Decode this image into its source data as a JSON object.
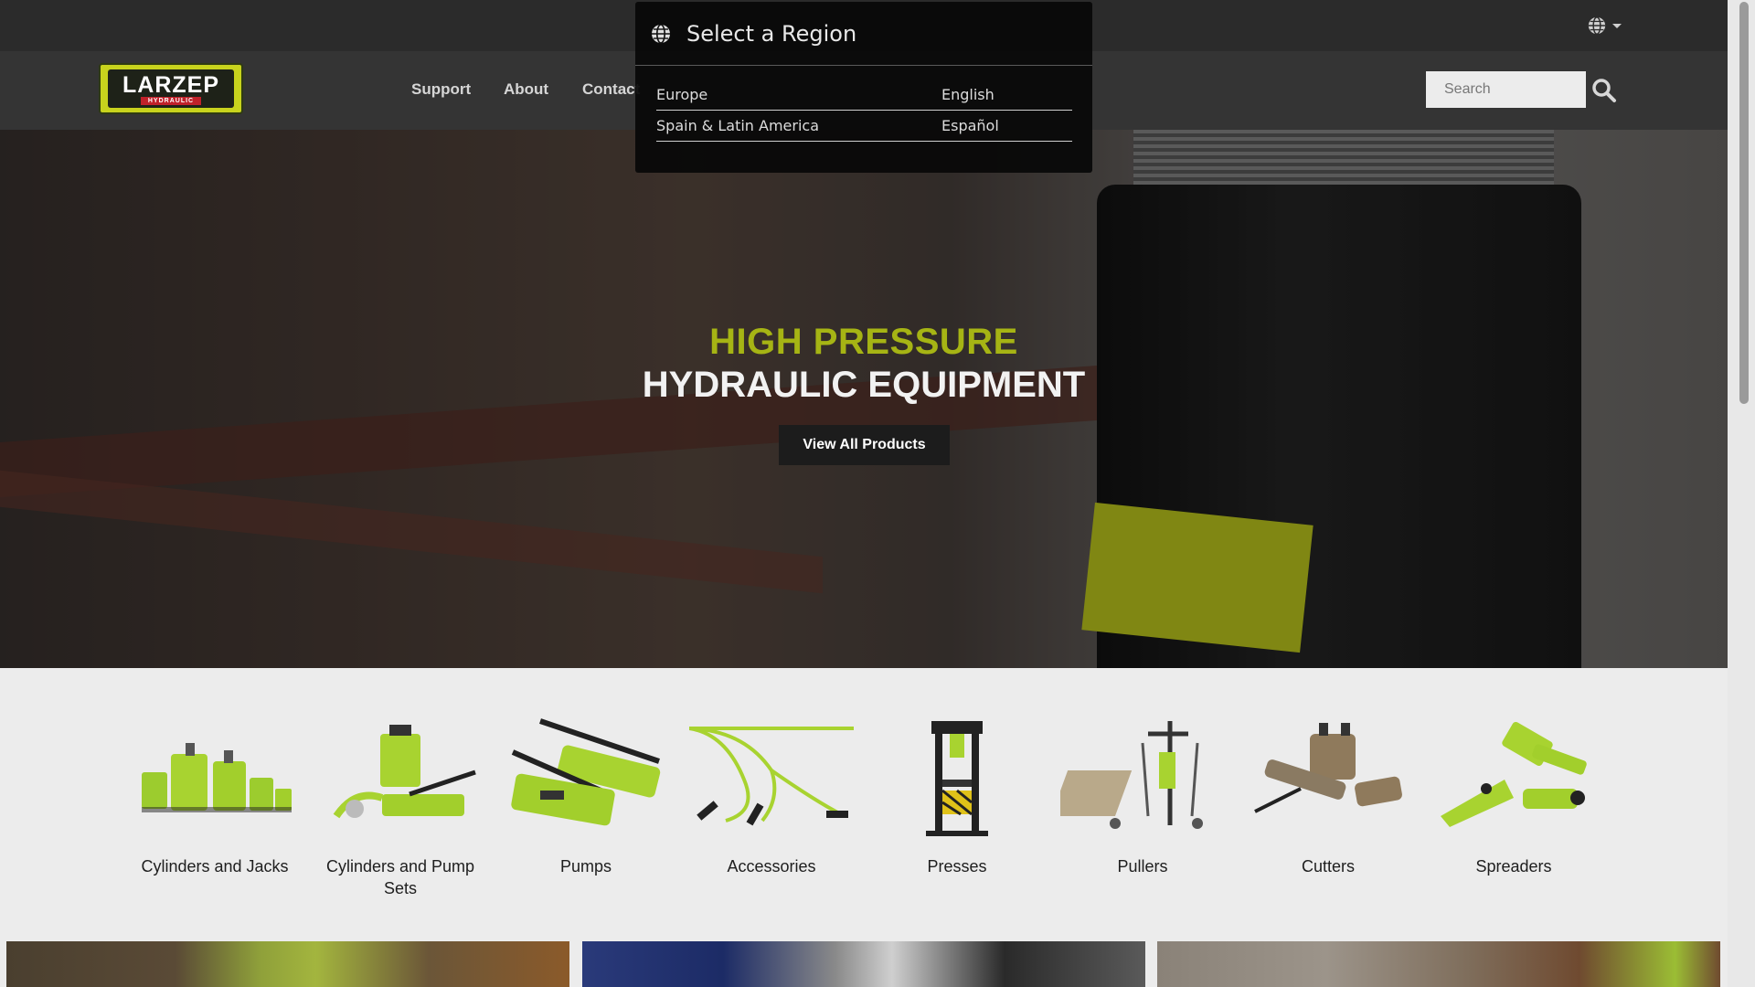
{
  "header": {
    "region_icon": "globe-icon"
  },
  "nav": {
    "logo_text": "LARZEP",
    "logo_subtext": "HYDRAULIC",
    "links": [
      {
        "label": "Support"
      },
      {
        "label": "About"
      },
      {
        "label": "Contact"
      }
    ],
    "search": {
      "placeholder": "Search",
      "value": "",
      "icon": "search-icon"
    }
  },
  "hero": {
    "title_line1": "HIGH PRESSURE",
    "title_line2": "HYDRAULIC EQUIPMENT",
    "cta_label": "View All Products"
  },
  "categories": [
    {
      "label": "Cylinders and Jacks"
    },
    {
      "label": "Cylinders and Pump Sets"
    },
    {
      "label": "Pumps"
    },
    {
      "label": "Accessories"
    },
    {
      "label": "Presses"
    },
    {
      "label": "Pullers"
    },
    {
      "label": "Cutters"
    },
    {
      "label": "Spreaders"
    }
  ],
  "region_modal": {
    "title": "Select a Region",
    "icon": "globe-icon",
    "regions": [
      {
        "name": "Europe",
        "language": "English"
      },
      {
        "name": "Spain & Latin America",
        "language": "Español"
      }
    ]
  },
  "colors": {
    "brand_green": "#a6b414",
    "logo_green": "#c8d31d",
    "topbar": "#2b2b2b",
    "navbar": "#343434"
  }
}
